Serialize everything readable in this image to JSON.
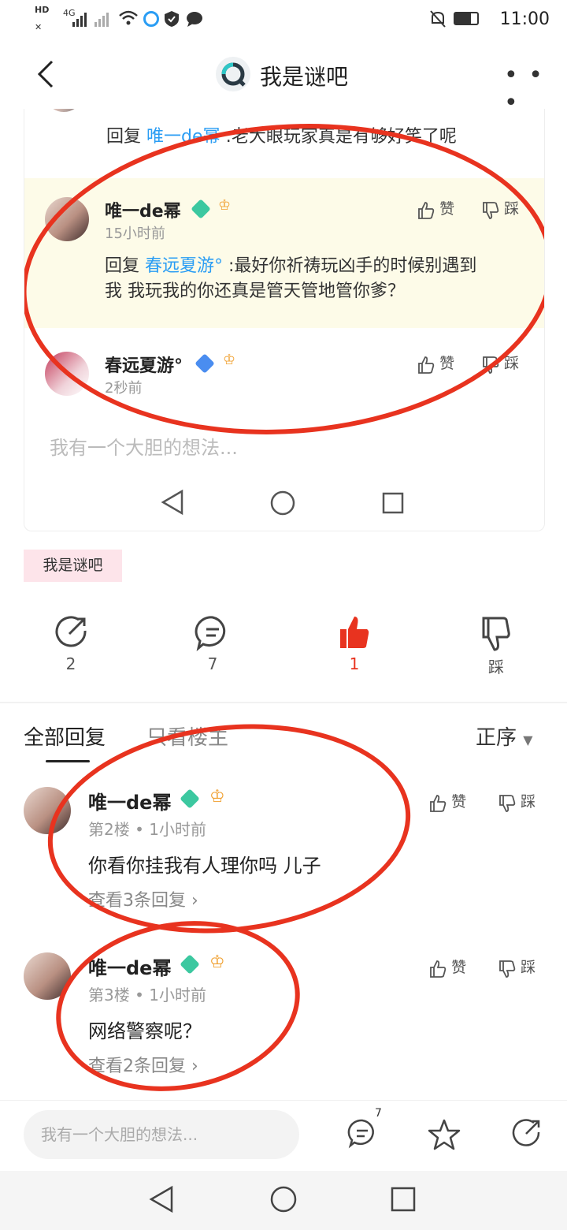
{
  "status_bar": {
    "left_icons": [
      "HD",
      "4G",
      "signal-icon",
      "wifi-icon",
      "app-icon",
      "shield-icon",
      "chat-icon"
    ],
    "time": "11:00"
  },
  "header": {
    "forum_title": "我是谜吧",
    "back_icon": "chevron-left-icon",
    "more_icon": "more-icon"
  },
  "card": {
    "top_reply": {
      "prefix": "回复 ",
      "target": "唯一de幂",
      "text": " :老大眼玩家真是有够好笑了呢"
    },
    "highlight_reply": {
      "username": "唯一de幂",
      "time": "15小时前",
      "prefix": "回复 ",
      "target": "春远夏游°",
      "text_line1": " :最好你祈祷玩凶手的时候别遇到",
      "text_line2": "我 我玩我的你还真是管天管地管你爹？",
      "like": "赞",
      "dislike": "踩"
    },
    "second_reply": {
      "username": "春远夏游°",
      "time": "2秒前",
      "like": "赞",
      "dislike": "踩"
    },
    "input_placeholder": "我有一个大胆的想法..."
  },
  "tag": "我是谜吧",
  "actions": {
    "share": "2",
    "comment": "7",
    "like": "1",
    "dislike": "踩"
  },
  "tabs": {
    "all": "全部回复",
    "owner_only": "只看楼主",
    "sort": "正序"
  },
  "posts": [
    {
      "username": "唯一de幂",
      "floor": "第2楼",
      "time": "1小时前",
      "text": "你看你挂我有人理你吗 儿子",
      "more": "查看3条回复",
      "like": "赞",
      "dislike": "踩"
    },
    {
      "username": "唯一de幂",
      "floor": "第3楼",
      "time": "1小时前",
      "text": "网络警察呢？",
      "more": "查看2条回复",
      "like": "赞",
      "dislike": "踩"
    }
  ],
  "bottom_bar": {
    "input_placeholder": "我有一个大胆的想法...",
    "comment_count": "7"
  },
  "colors": {
    "accent_red": "#e8331f",
    "link_blue": "#2a9df4",
    "tag_pink": "#fde4ea",
    "highlight_bg": "#fdfbe8"
  }
}
